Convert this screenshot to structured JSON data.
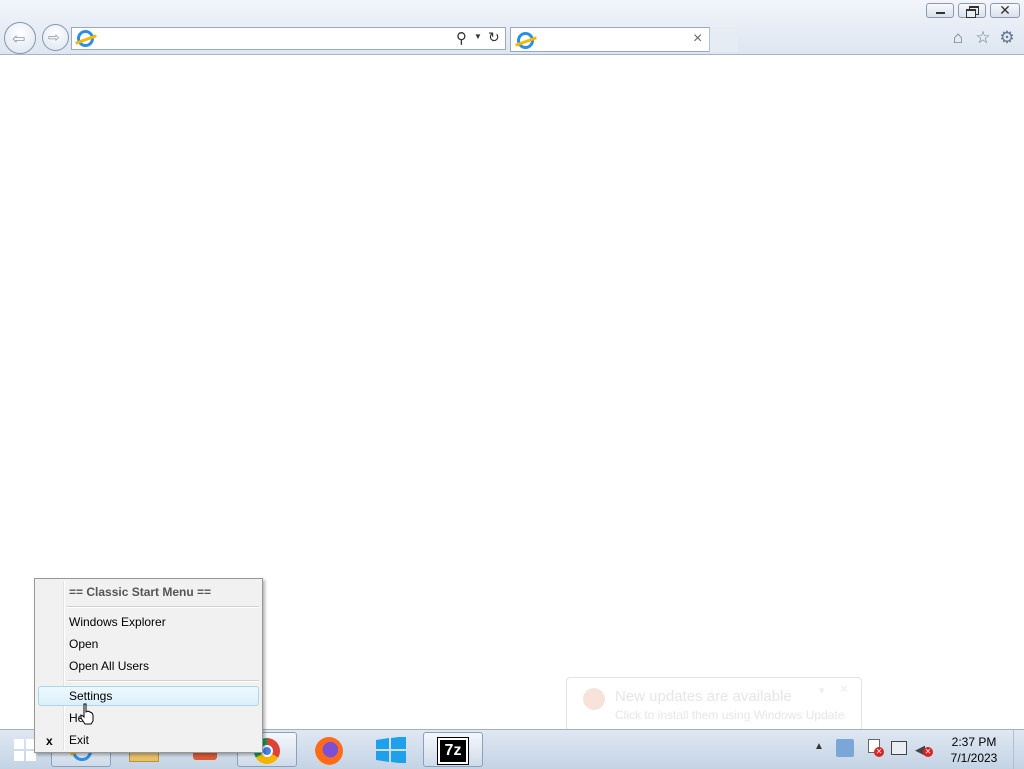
{
  "browser": {
    "address_value": "",
    "tab_title": "",
    "tab_close": "×"
  },
  "context_menu": {
    "header": "== Classic Start Menu ==",
    "items": [
      {
        "label": "Windows Explorer"
      },
      {
        "label": "Open"
      },
      {
        "label": "Open All Users"
      },
      {
        "label": "Settings",
        "highlighted": true
      },
      {
        "label": "Help"
      },
      {
        "label": "Exit",
        "marker": "x"
      }
    ]
  },
  "notification": {
    "title": "New updates are available",
    "body": "Click to install them using Windows Update"
  },
  "taskbar": {
    "apps": [
      {
        "icon": "windows-start-icon"
      },
      {
        "icon": "internet-explorer-icon",
        "active": true
      },
      {
        "icon": "file-explorer-icon"
      },
      {
        "icon": "media-player-icon"
      },
      {
        "icon": "chrome-icon",
        "active": true
      },
      {
        "icon": "firefox-icon"
      },
      {
        "icon": "windows-store-icon"
      },
      {
        "icon": "7zip-icon",
        "active": true,
        "text": "7z"
      }
    ],
    "clock": {
      "time": "2:37 PM",
      "date": "7/1/2023"
    }
  },
  "colors": {
    "ie_blue": "#2c8ee5",
    "menu_highlight": "#dcf0fa",
    "taskbar": "#c4d3e4"
  }
}
